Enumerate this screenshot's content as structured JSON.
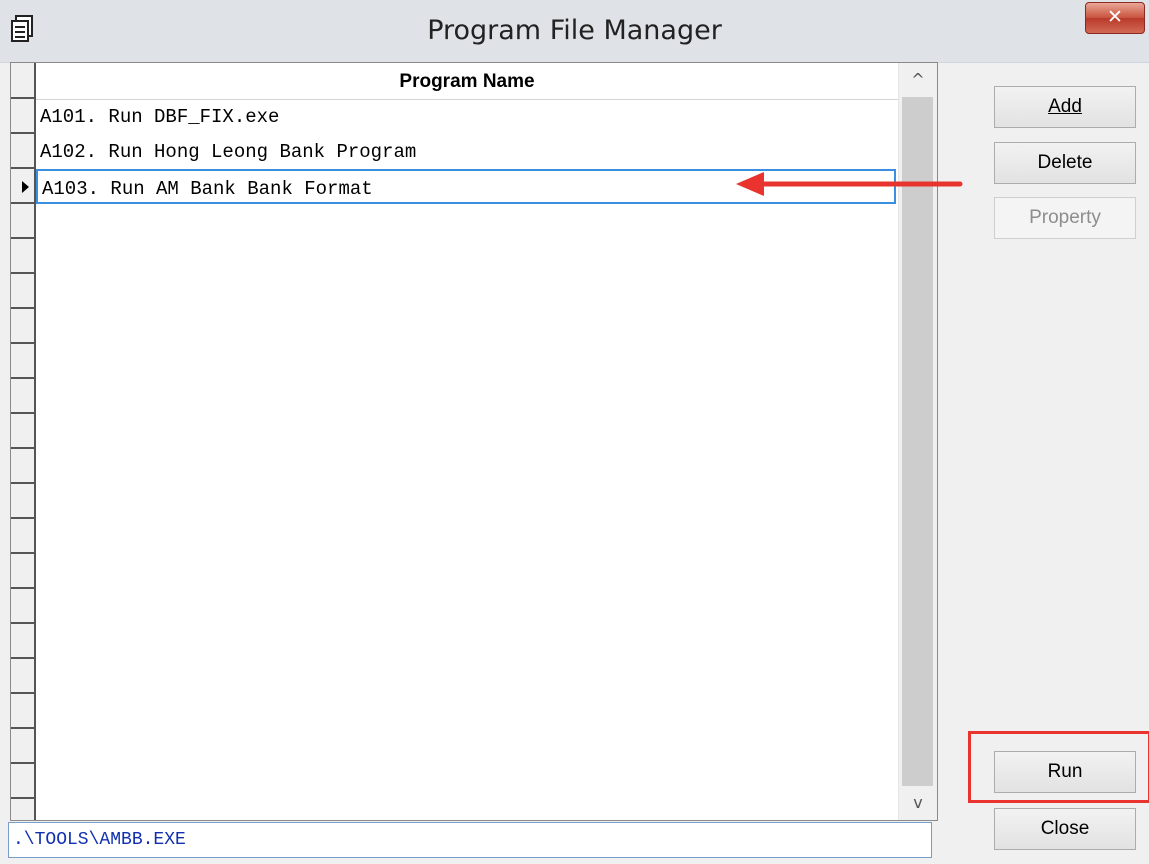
{
  "window": {
    "title": "Program File Manager",
    "close_label": "✕",
    "app_icon": "printer-stack-icon"
  },
  "grid": {
    "column_header": "Program Name",
    "rows": [
      "A101. Run DBF_FIX.exe",
      "A102. Run Hong Leong Bank Program",
      "A103. Run AM Bank Bank Format"
    ],
    "selected_index": 2,
    "scroll_up_icon": "^",
    "scroll_down_icon": "v"
  },
  "path_field": {
    "value": ".\\TOOLS\\AMBB.EXE"
  },
  "buttons": {
    "add": "Add",
    "delete": "Delete",
    "property": "Property",
    "run": "Run",
    "close": "Close"
  },
  "colors": {
    "annotation": "#e8332e",
    "selection_border": "#3b8fe0",
    "path_text": "#1030b0"
  }
}
